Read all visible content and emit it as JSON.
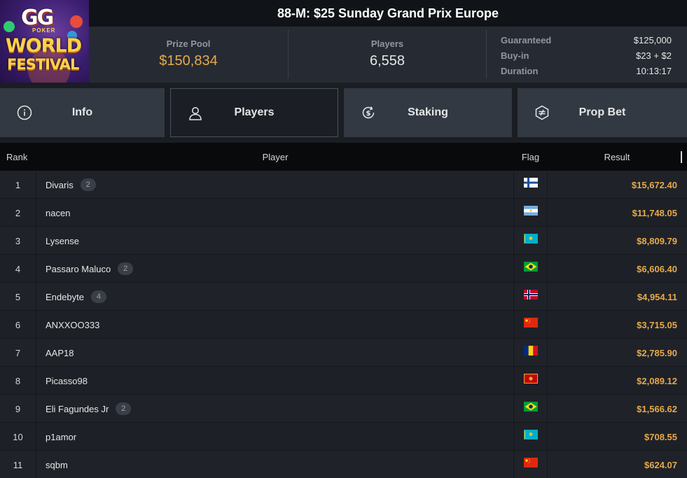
{
  "header": {
    "title": "88-M: $25 Sunday Grand Prix Europe",
    "logo": {
      "top": "GG",
      "sub": "POKER",
      "line1": "WORLD",
      "line2": "FESTIVAL"
    },
    "prize_pool": {
      "label": "Prize Pool",
      "value": "$150,834"
    },
    "players": {
      "label": "Players",
      "value": "6,558"
    },
    "details": [
      {
        "key": "Guaranteed",
        "value": "$125,000"
      },
      {
        "key": "Buy-in",
        "value": "$23 + $2"
      },
      {
        "key": "Duration",
        "value": "10:13:17"
      }
    ]
  },
  "tabs": [
    {
      "label": "Info",
      "icon": "info-icon",
      "active": false
    },
    {
      "label": "Players",
      "icon": "user-icon",
      "active": true
    },
    {
      "label": "Staking",
      "icon": "dollar-refresh-icon",
      "active": false
    },
    {
      "label": "Prop Bet",
      "icon": "prop-bet-icon",
      "active": false
    }
  ],
  "table": {
    "headers": {
      "rank": "Rank",
      "player": "Player",
      "flag": "Flag",
      "result": "Result"
    },
    "rows": [
      {
        "rank": "1",
        "player": "Divaris",
        "badge": "2",
        "flag": "finland",
        "result": "$15,672.40"
      },
      {
        "rank": "2",
        "player": "nacen",
        "badge": null,
        "flag": "argentina",
        "result": "$11,748.05"
      },
      {
        "rank": "3",
        "player": "Lysense",
        "badge": null,
        "flag": "kazakhstan",
        "result": "$8,809.79"
      },
      {
        "rank": "4",
        "player": "Passaro Maluco",
        "badge": "2",
        "flag": "brazil",
        "result": "$6,606.40"
      },
      {
        "rank": "5",
        "player": "Endebyte",
        "badge": "4",
        "flag": "norway",
        "result": "$4,954.11"
      },
      {
        "rank": "6",
        "player": "ANXXOO333",
        "badge": null,
        "flag": "china",
        "result": "$3,715.05"
      },
      {
        "rank": "7",
        "player": "AAP18",
        "badge": null,
        "flag": "romania",
        "result": "$2,785.90"
      },
      {
        "rank": "8",
        "player": "Picasso98",
        "badge": null,
        "flag": "montenegro",
        "result": "$2,089.12"
      },
      {
        "rank": "9",
        "player": "Eli Fagundes Jr",
        "badge": "2",
        "flag": "brazil",
        "result": "$1,566.62"
      },
      {
        "rank": "10",
        "player": "p1amor",
        "badge": null,
        "flag": "kazakhstan",
        "result": "$708.55"
      },
      {
        "rank": "11",
        "player": "sqbm",
        "badge": null,
        "flag": "china",
        "result": "$624.07"
      }
    ]
  },
  "colors": {
    "accent_gold": "#e8a94a",
    "header_bg": "#262b33",
    "title_bg": "#101317",
    "tab_bg": "#323943"
  }
}
